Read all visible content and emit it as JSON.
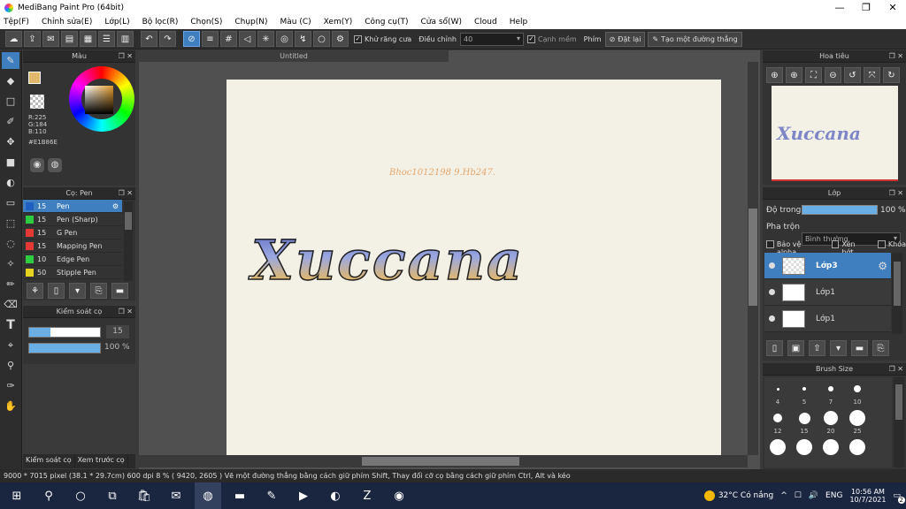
{
  "window": {
    "title": "MediBang Paint Pro (64bit)"
  },
  "menu": [
    "Tệp(F)",
    "Chỉnh sửa(E)",
    "Lớp(L)",
    "Bộ lọc(R)",
    "Chọn(S)",
    "Chụp(N)",
    "Màu (C)",
    "Xem(Y)",
    "Công cụ(T)",
    "Cửa sổ(W)",
    "Cloud",
    "Help"
  ],
  "toolbar": {
    "antialias_label": "Khử răng cưa",
    "adjust_label": "Điều chỉnh",
    "adjust_value": "40",
    "soft_edge_label": "Cạnh mềm",
    "key_label": "Phím",
    "set_label": "Đặt lại",
    "straight_label": "Tạo một đường thẳng"
  },
  "color_panel": {
    "title": "Màu",
    "r": "R:225",
    "g": "G:184",
    "b": "B:110",
    "hex": "#E1B86E",
    "fg_color": "#E1B86E"
  },
  "brush_panel": {
    "title": "Cọ: Pen",
    "items": [
      {
        "size": "15",
        "name": "Pen",
        "color": "#1f5fbf"
      },
      {
        "size": "15",
        "name": "Pen (Sharp)",
        "color": "#2ecc40"
      },
      {
        "size": "15",
        "name": "G Pen",
        "color": "#e53935"
      },
      {
        "size": "15",
        "name": "Mapping Pen",
        "color": "#e53935"
      },
      {
        "size": "10",
        "name": "Edge Pen",
        "color": "#2ecc40"
      },
      {
        "size": "50",
        "name": "Stipple Pen",
        "color": "#e6d220"
      }
    ]
  },
  "control_panel": {
    "title": "Kiểm soát cọ",
    "size_value": "15",
    "opacity_value": "100 %",
    "size_fraction": 0.3,
    "opacity_fraction": 1.0
  },
  "bottom_tabs": [
    "Kiểm soát cọ",
    "Xem trước cọ"
  ],
  "canvas": {
    "tab_title": "Untitled",
    "small_text": "Bhoc1012198 9.Hb247.",
    "big_text": "Xuccana"
  },
  "navigator": {
    "title": "Hoa tiêu",
    "thumb_text": "Xuccana"
  },
  "layer_panel": {
    "title": "Lớp",
    "opacity_label": "Độ trong",
    "opacity_value": "100 %",
    "blend_label": "Pha trộn",
    "blend_value": "Bình thường",
    "protect_alpha": "Bảo vệ alpha",
    "clip": "Xén bớt",
    "lock": "Khóa",
    "layers": [
      "Lớp3",
      "Lớp1",
      "Lớp1"
    ]
  },
  "brush_size": {
    "title": "Brush Size",
    "labels": [
      "4",
      "5",
      "7",
      "10",
      "12",
      "15",
      "20",
      "25"
    ]
  },
  "status": "9000 * 7015 pixel   (38.1 * 29.7cm)   600 dpi   8 %   ( 9420, 2605 )   Vẽ một đường thẳng bằng cách giữ phím Shift, Thay đổi cỡ cọ bằng cách giữ phím Ctrl, Alt và kéo",
  "taskbar": {
    "weather": "32°C  Có nắng",
    "lang": "ENG",
    "time": "10:56 AM",
    "date": "10/7/2021",
    "badge": "2"
  }
}
